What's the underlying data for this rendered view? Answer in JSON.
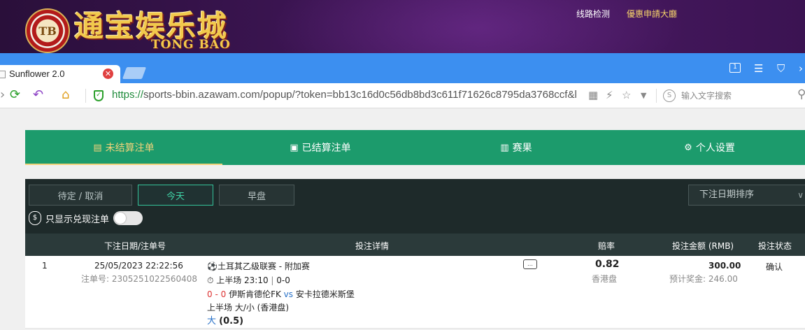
{
  "banner": {
    "logo_text": "通宝娱乐城",
    "logo_sub": "TONG BAO",
    "chip": "TB",
    "links": [
      "线路检测",
      "優惠申請大廳"
    ]
  },
  "browser": {
    "tab_title": "Sunflower 2.0",
    "url_scheme": "https://",
    "url_rest": "sports-bbin.azawam.com/popup/?token=bb13c16d0c56db8bd3c611f71626c8795da3768ccf&l",
    "search_placeholder": "输入文字搜索"
  },
  "nav": {
    "items": [
      {
        "label": "未结算注单",
        "icon": "receipt-icon"
      },
      {
        "label": "已结算注单",
        "icon": "settled-icon"
      },
      {
        "label": "赛果",
        "icon": "scoreboard-icon"
      },
      {
        "label": "个人设置",
        "icon": "gear-icon"
      }
    ]
  },
  "filters": {
    "buttons": [
      "待定 / 取消",
      "今天",
      "早盘"
    ],
    "active": "今天",
    "sort_label": "下注日期排序",
    "cashout_label": "只显示兑现注单"
  },
  "table": {
    "headers": [
      "下注日期/注单号",
      "投注详情",
      "赔率",
      "投注金额 (RMB)",
      "投注状态"
    ],
    "rows": [
      {
        "index": "1",
        "date": "25/05/2023 22:22:56",
        "order_no": "注单号: 2305251022560408",
        "league": "土耳其乙级联赛 - 附加赛",
        "period_time": "上半场 23:10",
        "period_score": "0-0",
        "score": "0 - 0",
        "home": "伊斯肯德伦FK",
        "vs": "vs",
        "away": "安卡拉德米斯堡",
        "market": "上半场 大/小 (香港盘)",
        "selection": "大",
        "line": "(0.5)",
        "odds": "0.82",
        "odds_type": "香港盘",
        "stake": "300.00",
        "payout": "预计奖金: 246.00",
        "status": "确认"
      }
    ]
  }
}
